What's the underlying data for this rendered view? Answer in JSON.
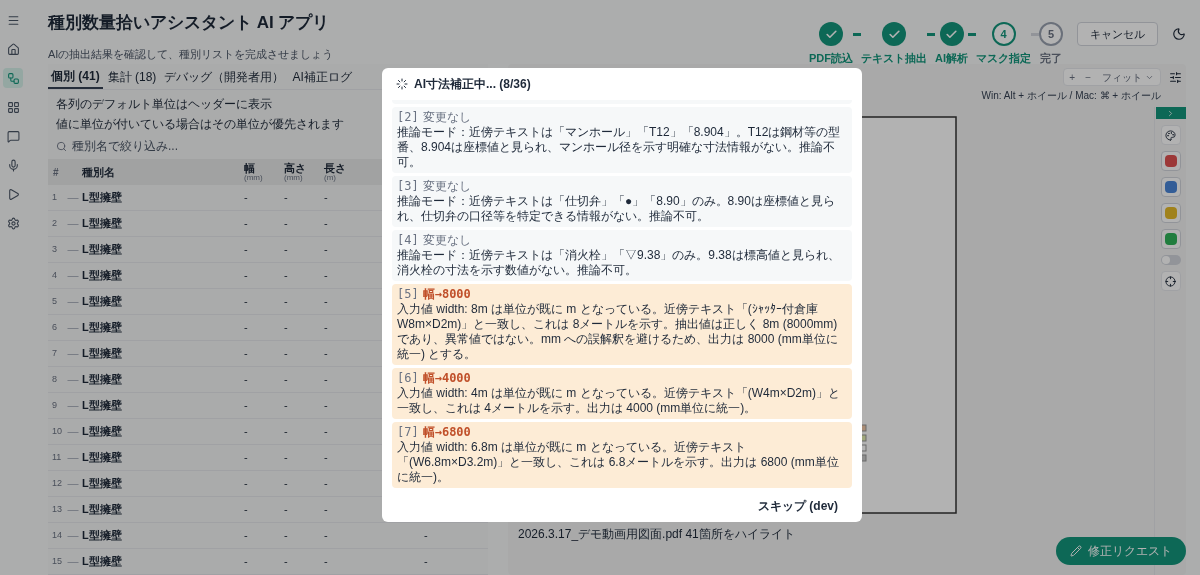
{
  "app": {
    "title": "種別数量拾いアシスタント AI アプリ",
    "subtitle": "AIの抽出結果を確認して、種別リストを完成させましょう"
  },
  "nav_rail": [
    {
      "selected": false
    },
    {
      "selected": false
    },
    {
      "selected": true
    },
    {
      "selected": false
    },
    {
      "selected": false
    },
    {
      "selected": false
    },
    {
      "selected": false
    },
    {
      "selected": false
    }
  ],
  "stepper": [
    {
      "label": "PDF読込",
      "done": true,
      "current": false
    },
    {
      "label": "テキスト抽出",
      "done": true,
      "current": false
    },
    {
      "label": "AI解析",
      "done": true,
      "current": false
    },
    {
      "label": "マスク指定",
      "number": "4",
      "done": false,
      "current": true
    },
    {
      "label": "完了",
      "number": "5",
      "done": false,
      "current": false
    }
  ],
  "cancel_button": "キャンセル",
  "tabs": [
    {
      "label": "個別 (41)",
      "selected": true
    },
    {
      "label": "集計 (18)",
      "selected": false
    },
    {
      "label": "デバッグ（開発者用）",
      "selected": false
    },
    {
      "label": "AI補正ログ",
      "selected": false
    }
  ],
  "notes": [
    "各列のデフォルト単位はヘッダーに表示",
    "値に単位が付いている場合はその単位が優先されます"
  ],
  "search": {
    "placeholder": "種別名で絞り込み..."
  },
  "table": {
    "columns": [
      {
        "label": "#"
      },
      {
        "label": "種別名"
      },
      {
        "label": "幅",
        "unit": "(mm)"
      },
      {
        "label": "高さ",
        "unit": "(mm)"
      },
      {
        "label": "長さ",
        "unit": "(m)"
      }
    ],
    "rows": [
      {
        "no": "1",
        "mark": "—",
        "name": "L型擁壁",
        "width": "-",
        "height": "-",
        "length": "-"
      },
      {
        "no": "2",
        "mark": "—",
        "name": "L型擁壁",
        "width": "-",
        "height": "-",
        "length": "-"
      },
      {
        "no": "3",
        "mark": "—",
        "name": "L型擁壁",
        "width": "-",
        "height": "-",
        "length": "-"
      },
      {
        "no": "4",
        "mark": "—",
        "name": "L型擁壁",
        "width": "-",
        "height": "-",
        "length": "-"
      },
      {
        "no": "5",
        "mark": "—",
        "name": "L型擁壁",
        "width": "-",
        "height": "-",
        "length": "-"
      },
      {
        "no": "6",
        "mark": "—",
        "name": "L型擁壁",
        "width": "-",
        "height": "-",
        "length": "-"
      },
      {
        "no": "7",
        "mark": "—",
        "name": "L型擁壁",
        "width": "-",
        "height": "-",
        "length": "-"
      },
      {
        "no": "8",
        "mark": "—",
        "name": "L型擁壁",
        "width": "-",
        "height": "-",
        "length": "-"
      },
      {
        "no": "9",
        "mark": "—",
        "name": "L型擁壁",
        "width": "-",
        "height": "-",
        "length": "-"
      },
      {
        "no": "10",
        "mark": "—",
        "name": "L型擁壁",
        "width": "-",
        "height": "-",
        "length": "-"
      },
      {
        "no": "11",
        "mark": "—",
        "name": "L型擁壁",
        "width": "-",
        "height": "-",
        "length": "-"
      },
      {
        "no": "12",
        "mark": "—",
        "name": "L型擁壁",
        "width": "-",
        "height": "-",
        "length": "-"
      },
      {
        "no": "13",
        "mark": "—",
        "name": "L型擁壁",
        "width": "-",
        "height": "-",
        "length": "-"
      },
      {
        "no": "14",
        "mark": "—",
        "name": "L型擁壁",
        "width": "-",
        "height": "-",
        "length": "-",
        "column_6": "-"
      },
      {
        "no": "15",
        "mark": "—",
        "name": "L型擁壁",
        "width": "-",
        "height": "-",
        "length": "-",
        "column_6": "-"
      }
    ]
  },
  "viewer": {
    "zoom_in": "+",
    "zoom_out": "−",
    "fit": "フィット",
    "hint": "Win: Alt + ホイール / Mac: ⌘ + ホイール",
    "caption": "2026.3.17_デモ動画用図面.pdf 41箇所をハイライト"
  },
  "tool_panel": {
    "colors": [
      {
        "color": "#9d3939"
      },
      {
        "color": "#345e97"
      },
      {
        "color": "#a1821d"
      },
      {
        "color": "#217d3f"
      }
    ],
    "toggle_on": false
  },
  "fix_request_button": "修正リクエスト",
  "dialog": {
    "title": "AI寸法補正中... (8/36)",
    "entries": [
      {
        "kind": "unchanged",
        "index": "[2]",
        "result": "変更なし",
        "text": "推論モード：近傍テキストは「マンホール」「T12」「8.904」。T12は鋼材等の型番、8.904は座標値と見られ、マンホール径を示す明確な寸法情報がない。推論不可。"
      },
      {
        "kind": "unchanged",
        "index": "[3]",
        "result": "変更なし",
        "text": "推論モード：近傍テキストは「仕切弁」「●」「8.90」のみ。8.90は座標値と見られ、仕切弁の口径等を特定できる情報がない。推論不可。"
      },
      {
        "kind": "unchanged",
        "index": "[4]",
        "result": "変更なし",
        "text": "推論モード：近傍テキストは「消火栓」「▽9.38」のみ。9.38は標高値と見られ、消火栓の寸法を示す数値がない。推論不可。"
      },
      {
        "kind": "changed",
        "index": "[5]",
        "result": "幅→8000",
        "text": "入力値 width: 8m は単位が既に m となっている。近傍テキスト「(ｼｬｯﾀｰ付倉庫W8m×D2m)」と一致し、これは 8メートルを示す。抽出値は正しく 8m (8000mm) であり、異常値ではない。mm への誤解釈を避けるため、出力は 8000 (mm単位に統一) とする。"
      },
      {
        "kind": "changed",
        "index": "[6]",
        "result": "幅→4000",
        "text": "入力値 width: 4m は単位が既に m となっている。近傍テキスト「(W4m×D2m)」と一致し、これは 4メートルを示す。出力は 4000 (mm単位に統一)。"
      },
      {
        "kind": "changed",
        "index": "[7]",
        "result": "幅→6800",
        "text": "入力値 width: 6.8m は単位が既に m となっている。近傍テキスト「(W6.8m×D3.2m)」と一致し、これは 6.8メートルを示す。出力は 6800 (mm単位に統一)。"
      }
    ],
    "skip_button": "スキップ (dev)"
  }
}
